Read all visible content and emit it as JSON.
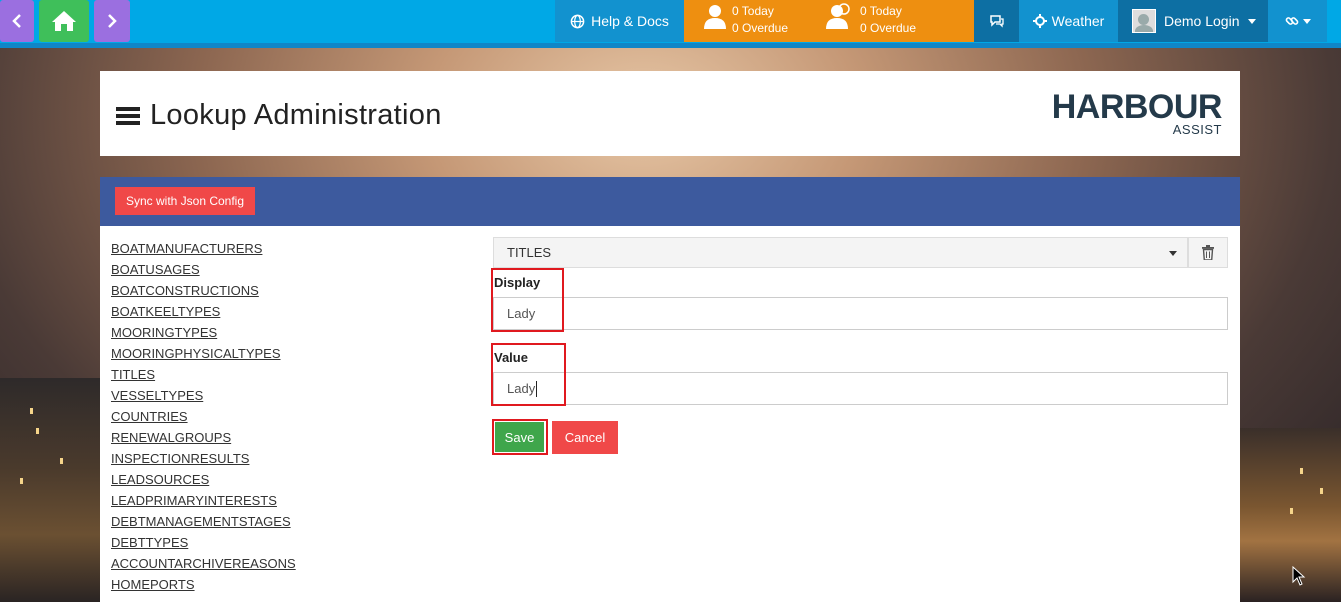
{
  "topbar": {
    "help_label": "Help & Docs",
    "overdue_a": {
      "today": "0 Today",
      "overdue": "0 Overdue"
    },
    "overdue_b": {
      "today": "0 Today",
      "overdue": "0 Overdue"
    },
    "weather_label": "Weather",
    "login_label": "Demo Login"
  },
  "header": {
    "title": "Lookup Administration",
    "logo_main": "HARBOUR",
    "logo_sub": "ASSIST"
  },
  "toolbar": {
    "sync_label": "Sync with Json Config"
  },
  "lookups": [
    "BOATMANUFACTURERS",
    "BOATUSAGES",
    "BOATCONSTRUCTIONS",
    "BOATKEELTYPES",
    "MOORINGTYPES",
    "MOORINGPHYSICALTYPES",
    "TITLES",
    "VESSELTYPES",
    "COUNTRIES",
    "RENEWALGROUPS",
    "INSPECTIONRESULTS",
    "LEADSOURCES",
    "LEADPRIMARYINTERESTS",
    "DEBTMANAGEMENTSTAGES",
    "DEBTTYPES",
    "ACCOUNTARCHIVEREASONS",
    "HOMEPORTS"
  ],
  "form": {
    "selected_lookup": "TITLES",
    "display_label": "Display",
    "display_value": "Lady",
    "value_label": "Value",
    "value_value": "Lady",
    "save_label": "Save",
    "cancel_label": "Cancel"
  },
  "colors": {
    "topbar": "#00a8e6",
    "orange": "#ee8f10",
    "nav_purple": "#9b6fe0",
    "nav_green": "#3fbf5a",
    "bluebar": "#3d5a9e",
    "danger": "#f04848",
    "success": "#3fa64b",
    "highlight": "#e0191f"
  },
  "icons": [
    "chevron-left-icon",
    "home-icon",
    "chevron-right-icon",
    "globe-icon",
    "person-icon",
    "people-icon",
    "chat-icon",
    "gear-icon",
    "user-avatar-icon",
    "link-icon",
    "hamburger-icon",
    "trash-icon",
    "caret-down-icon",
    "mouse-cursor-icon"
  ]
}
